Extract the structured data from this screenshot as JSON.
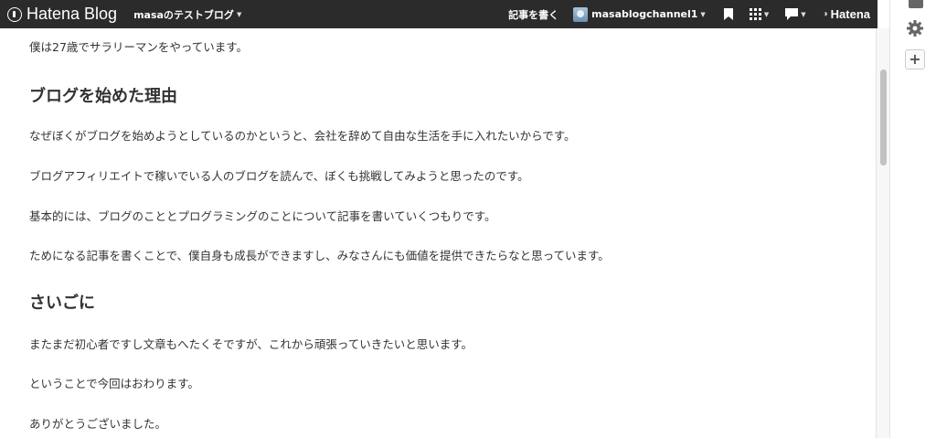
{
  "navbar": {
    "brand": "Hatena Blog",
    "blog_name": "masaのテストブログ",
    "write_label": "記事を書く",
    "username": "masablogchannel1",
    "hatena_label": "Hatena"
  },
  "article": {
    "p_intro": "僕は27歳でサラリーマンをやっています。",
    "h_reason": "ブログを始めた理由",
    "p1": "なぜぼくがブログを始めようとしているのかというと、会社を辞めて自由な生活を手に入れたいからです。",
    "p2": "ブログアフィリエイトで稼いでいる人のブログを読んで、ぼくも挑戦してみようと思ったのです。",
    "p3": "基本的には、ブログのこととプログラミングのことについて記事を書いていくつもりです。",
    "p4": "ためになる記事を書くことで、僕自身も成長ができますし、みなさんにも価値を提供できたらなと思っています。",
    "h_end": "さいごに",
    "p5": "またまだ初心者ですし文章もへたくそですが、これから頑張っていきたいと思います。",
    "p6": "ということで今回はおわります。",
    "p7": "ありがとうございました。"
  },
  "icons": {
    "bookmark": "bookmark-icon",
    "apps": "apps-grid-icon",
    "notifications": "speech-bubble-icon",
    "settings": "gear-icon",
    "add": "plus-icon"
  },
  "colors": {
    "navbar_bg": "#2b2b2b",
    "text": "#333333"
  }
}
